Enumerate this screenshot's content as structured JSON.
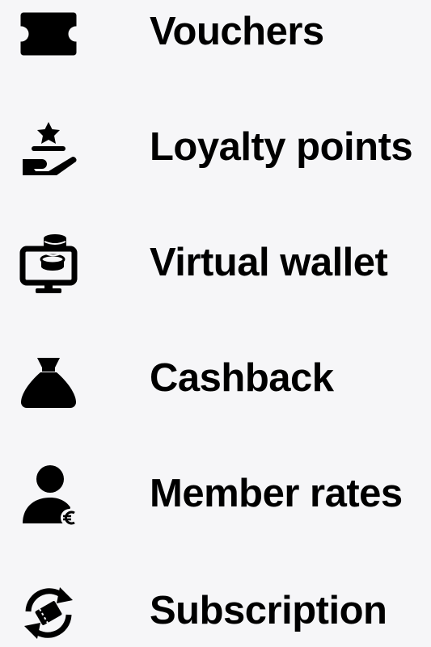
{
  "features": [
    {
      "icon": "ticket-icon",
      "label": "Vouchers"
    },
    {
      "icon": "hand-star-icon",
      "label": "Loyalty points"
    },
    {
      "icon": "monitor-coins-icon",
      "label": "Virtual wallet"
    },
    {
      "icon": "money-bag-icon",
      "label": "Cashback"
    },
    {
      "icon": "user-euro-icon",
      "label": "Member rates"
    },
    {
      "icon": "refresh-ticket-icon",
      "label": "Subscription"
    }
  ],
  "colors": {
    "background": "#f6f6f8",
    "text": "#000000",
    "icon": "#000000"
  }
}
